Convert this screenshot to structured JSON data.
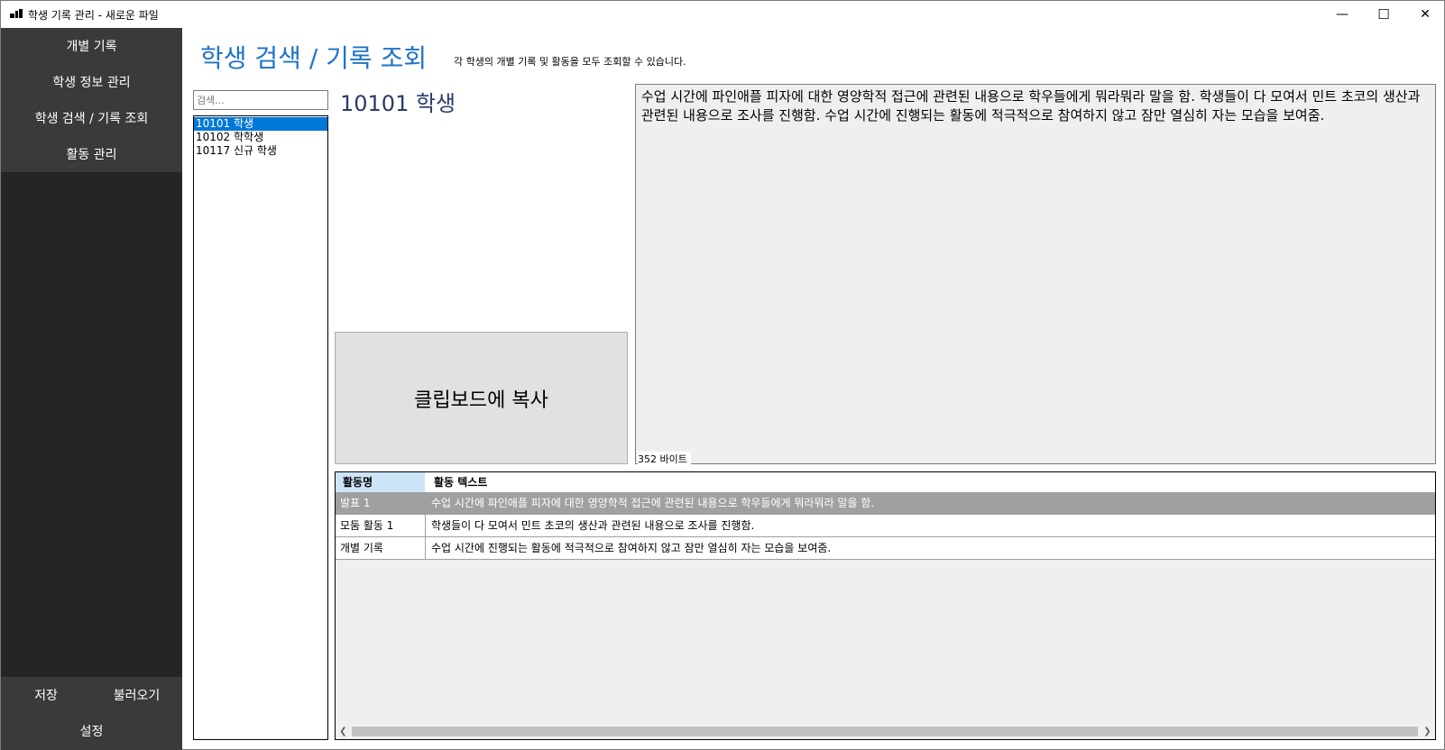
{
  "window": {
    "title": "학생 기록 관리 - 새로운 파일",
    "minimize_glyph": "—",
    "maximize_glyph": "☐",
    "close_glyph": "✕"
  },
  "sidebar": {
    "items": [
      {
        "label": "개별 기록"
      },
      {
        "label": "학생 정보 관리"
      },
      {
        "label": "학생 검색 / 기록 조회"
      },
      {
        "label": "활동 관리"
      }
    ],
    "save_label": "저장",
    "load_label": "불러오기",
    "settings_label": "설정"
  },
  "header": {
    "title": "학생 검색 / 기록 조회",
    "subtitle": "각 학생의 개별 기록 및 활동을 모두 조회할 수 있습니다."
  },
  "search": {
    "placeholder": "검색...",
    "value": ""
  },
  "students": [
    {
      "label": "10101 학생",
      "selected": true
    },
    {
      "label": "10102 학학생",
      "selected": false
    },
    {
      "label": "10117 신규 학생",
      "selected": false
    }
  ],
  "selected_student": {
    "name": "10101 학생"
  },
  "copy_button_label": "클립보드에 복사",
  "record": {
    "text": "수업 시간에 파인애플 피자에 대한 영양학적 접근에 관련된 내용으로 학우들에게 뭐라뭐라 말을 함. 학생들이 다 모여서 민트 초코의 생산과 관련된 내용으로 조사를 진행함. 수업 시간에 진행되는 활동에 적극적으로 참여하지 않고 잠만 열심히 자는 모습을 보여줌.",
    "byte_count": "352 바이트"
  },
  "activity_table": {
    "columns": [
      "활동명",
      "활동 텍스트"
    ],
    "rows": [
      {
        "name": "발표 1",
        "text": "수업 시간에 파인애플 피자에 대한 영양학적 접근에 관련된 내용으로 학우들에게 뭐라뭐라 말을 함.",
        "selected": true
      },
      {
        "name": "모둠 활동 1",
        "text": "학생들이 다 모여서 민트 초코의 생산과 관련된 내용으로 조사를 진행함.",
        "selected": false
      },
      {
        "name": "개별 기록",
        "text": "수업 시간에 진행되는 활동에 적극적으로 참여하지 않고 잠만 열심히 자는 모습을 보여줌.",
        "selected": false
      }
    ]
  },
  "colors": {
    "accent": "#1e73c8",
    "sidebar_bg": "#252525",
    "sidebar_group_bg": "#3a3a3a",
    "selection": "#0078d7",
    "row_selected": "#a0a0a0"
  },
  "icons": {
    "app": "app-icon",
    "scroll_left": "chevron-left-icon",
    "scroll_right": "chevron-right-icon"
  }
}
